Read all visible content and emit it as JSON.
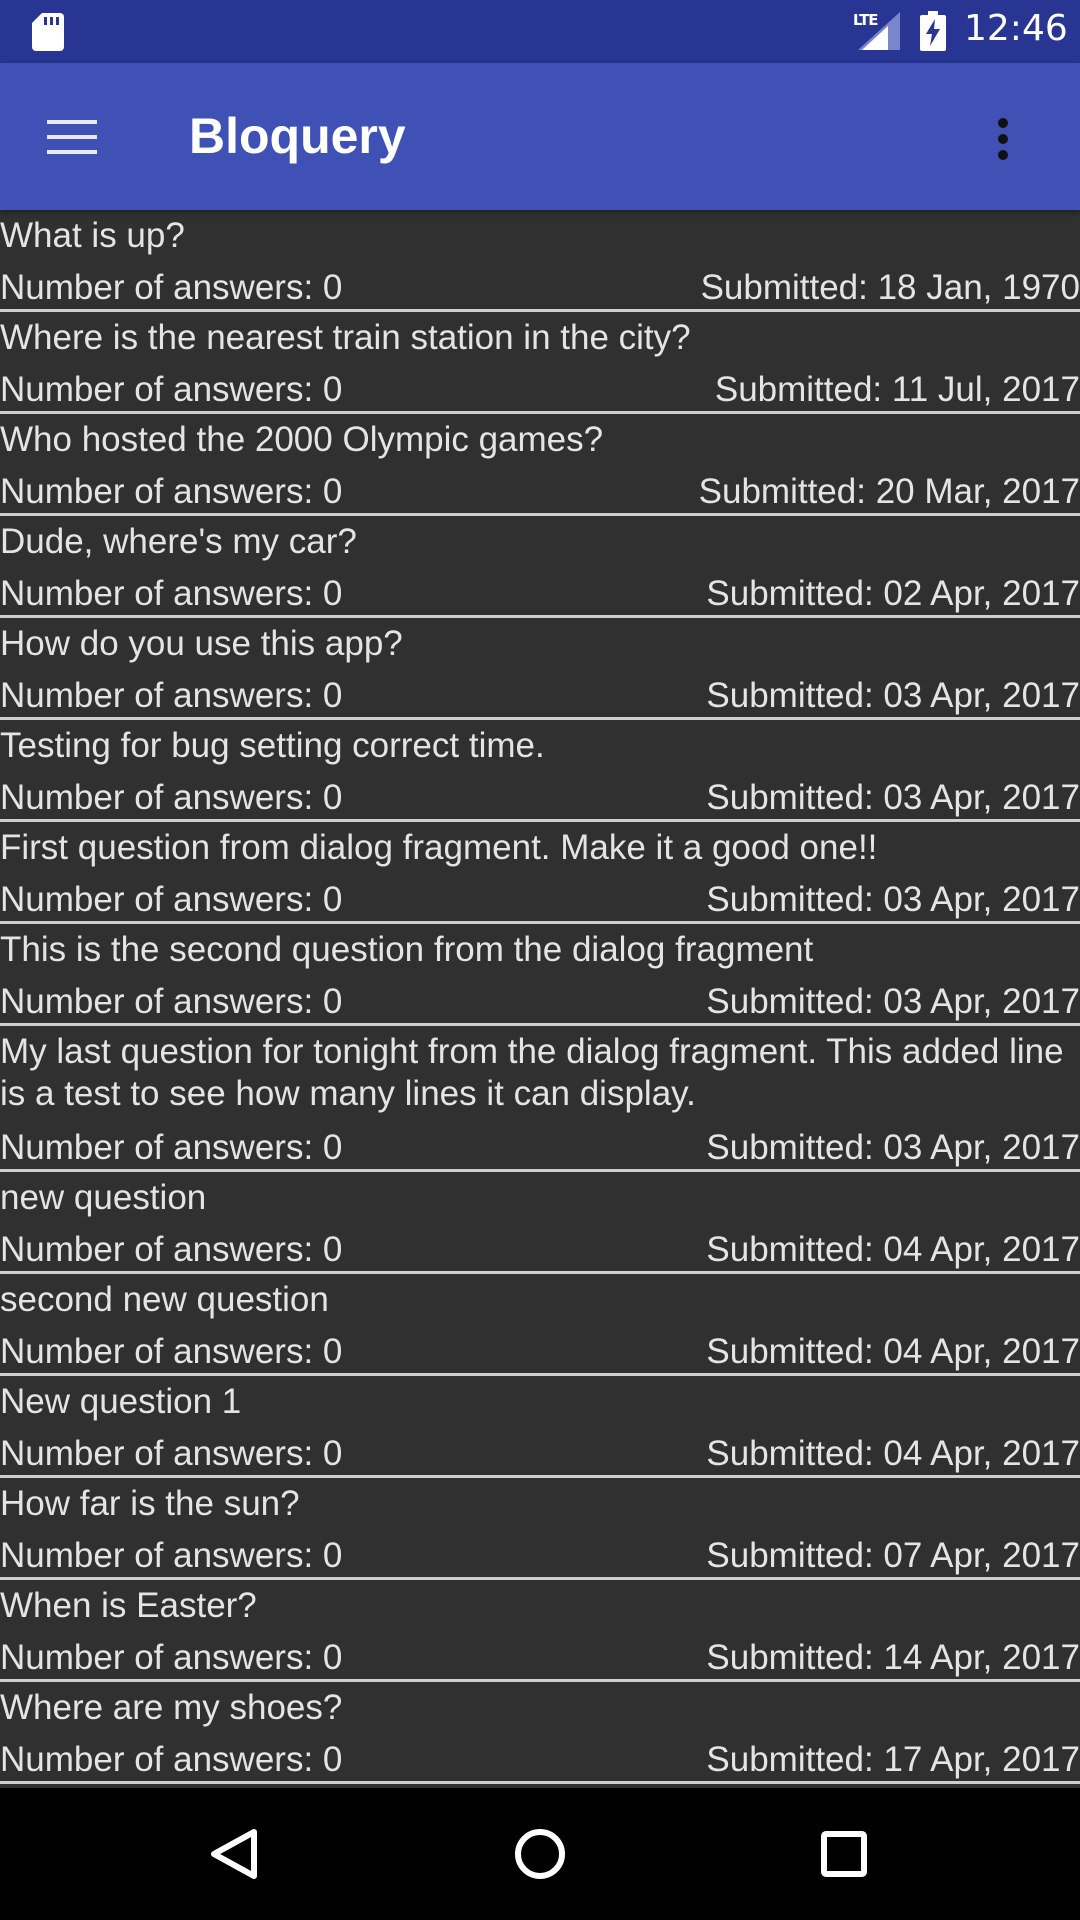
{
  "status_bar": {
    "time": "12:46",
    "network": "LTE",
    "icons": [
      "sd-card-icon",
      "signal-icon",
      "battery-charging-icon"
    ]
  },
  "app_bar": {
    "title": "Bloquery",
    "menu_icon": "hamburger-menu-icon",
    "overflow_icon": "more-vert-icon",
    "color": "#3f51b5"
  },
  "questions": [
    {
      "text": "What is up?",
      "answers": "Number of answers: 0",
      "submitted": "Submitted: 18 Jan, 1970"
    },
    {
      "text": "Where is the nearest train station in the city?",
      "answers": "Number of answers: 0",
      "submitted": "Submitted: 11 Jul, 2017"
    },
    {
      "text": "Who hosted the 2000 Olympic games?",
      "answers": "Number of answers: 0",
      "submitted": "Submitted: 20 Mar, 2017"
    },
    {
      "text": "Dude, where's my car?",
      "answers": "Number of answers: 0",
      "submitted": "Submitted: 02 Apr, 2017"
    },
    {
      "text": "How do you use this app?",
      "answers": "Number of answers: 0",
      "submitted": "Submitted: 03 Apr, 2017"
    },
    {
      "text": "Testing for bug setting correct time.",
      "answers": "Number of answers: 0",
      "submitted": "Submitted: 03 Apr, 2017"
    },
    {
      "text": "First question from dialog fragment. Make it a good one!!",
      "answers": "Number of answers: 0",
      "submitted": "Submitted: 03 Apr, 2017"
    },
    {
      "text": "This is the second question from the dialog fragment",
      "answers": "Number of answers: 0",
      "submitted": "Submitted: 03 Apr, 2017"
    },
    {
      "text": "My last question for tonight from the dialog fragment. This added line is a test to see how many lines it can display.",
      "answers": "Number of answers: 0",
      "submitted": "Submitted: 03 Apr, 2017"
    },
    {
      "text": "new question",
      "answers": "Number of answers: 0",
      "submitted": "Submitted: 04 Apr, 2017"
    },
    {
      "text": "second new question",
      "answers": "Number of answers: 0",
      "submitted": "Submitted: 04 Apr, 2017"
    },
    {
      "text": "New question 1",
      "answers": "Number of answers: 0",
      "submitted": "Submitted: 04 Apr, 2017"
    },
    {
      "text": "How far is the sun?",
      "answers": "Number of answers: 0",
      "submitted": "Submitted: 07 Apr, 2017"
    },
    {
      "text": "When is Easter?",
      "answers": "Number of answers: 0",
      "submitted": "Submitted: 14 Apr, 2017"
    },
    {
      "text": "Where are my shoes?",
      "answers": "Number of answers: 0",
      "submitted": "Submitted: 17 Apr, 2017"
    }
  ],
  "nav_bar": {
    "icons": [
      "back-icon",
      "home-icon",
      "recents-icon"
    ]
  }
}
